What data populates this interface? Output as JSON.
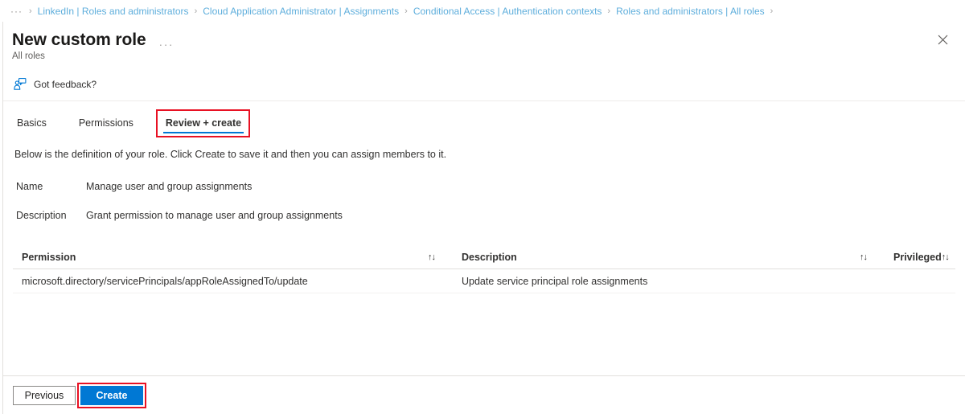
{
  "breadcrumb": {
    "ellipsis": "···",
    "separator": "›",
    "items": [
      "LinkedIn | Roles and administrators",
      "Cloud Application Administrator | Assignments",
      "Conditional Access | Authentication contexts",
      "Roles and administrators | All roles"
    ]
  },
  "blade": {
    "title": "New custom role",
    "more_label": "···",
    "subtitle": "All roles",
    "close_label": "✕"
  },
  "feedback": {
    "label": "Got feedback?",
    "icon": "feedback-person-icon"
  },
  "tabs": [
    {
      "label": "Basics",
      "active": false
    },
    {
      "label": "Permissions",
      "active": false
    },
    {
      "label": "Review + create",
      "active": true
    }
  ],
  "content": {
    "intro": "Below is the definition of your role. Click Create to save it and then you can assign members to it.",
    "fields": [
      {
        "label": "Name",
        "value": "Manage user and group assignments"
      },
      {
        "label": "Description",
        "value": "Grant permission to manage user and group assignments"
      }
    ]
  },
  "table": {
    "sort_icon": "↑↓",
    "columns": [
      "Permission",
      "Description",
      "Privileged"
    ],
    "rows": [
      {
        "permission": "microsoft.directory/servicePrincipals/appRoleAssignedTo/update",
        "description": "Update service principal role assignments",
        "privileged": ""
      }
    ]
  },
  "footer": {
    "previous_label": "Previous",
    "create_label": "Create"
  },
  "colors": {
    "accent": "#0078d4",
    "breadcrumb_link": "#5eaedc",
    "annotation": "#e81123",
    "divider": "#e1dfdd"
  }
}
